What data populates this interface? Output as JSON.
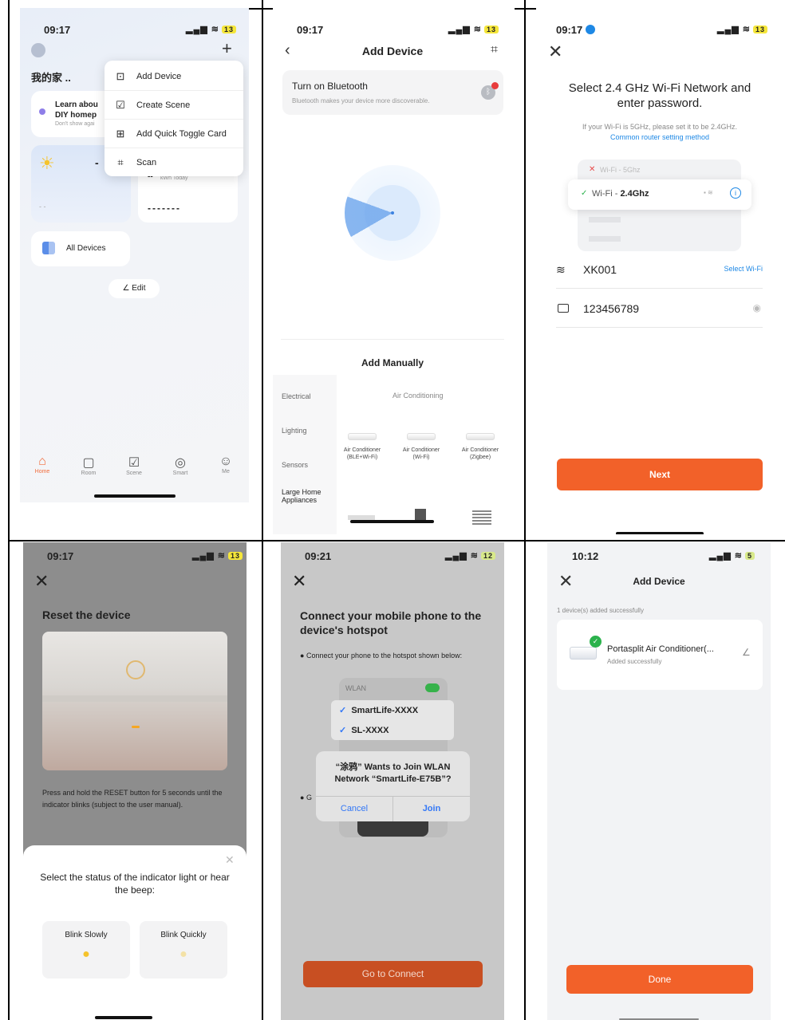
{
  "panel1": {
    "status": {
      "time": "09:17",
      "battery": "13"
    },
    "home_name": "我的家 ..",
    "promo_title": "Learn abou",
    "promo_title2": "DIY homep",
    "promo_sub": "Don't show agai",
    "energy_dash": "--",
    "energy_unit": "kWh Today",
    "energy_value": "-------",
    "weather_dash": "-",
    "weather_dash2": "- -",
    "all_devices": "All Devices",
    "edit": "Edit",
    "menu": [
      "Add Device",
      "Create Scene",
      "Add Quick Toggle Card",
      "Scan"
    ],
    "tabs": [
      "Home",
      "Room",
      "Scene",
      "Smart",
      "Me"
    ]
  },
  "panel2": {
    "status": {
      "time": "09:17",
      "battery": "13"
    },
    "title": "Add Device",
    "bt_title": "Turn on Bluetooth",
    "bt_sub": "Bluetooth makes your device more discoverable.",
    "add_manually": "Add Manually",
    "categories": [
      "Electrical",
      "Lighting",
      "Sensors",
      "Large Home Appliances"
    ],
    "section_label": "Air Conditioning",
    "products": [
      "Air Conditioner (BLE+Wi-Fi)",
      "Air Conditioner (Wi-Fi)",
      "Air Conditioner (Zigbee)"
    ]
  },
  "panel3": {
    "status": {
      "time": "09:17",
      "battery": "13"
    },
    "heading": "Select 2.4 GHz Wi-Fi Network and enter password.",
    "hint": "If your Wi-Fi is 5GHz, please set it to be 2.4GHz.",
    "link": "Common router setting method",
    "wifi_5g": "Wi-Fi - 5Ghz",
    "wifi_24_prefix": "Wi-Fi - ",
    "wifi_24_band": "2.4Ghz",
    "ssid": "XK001",
    "select_wifi": "Select Wi-Fi",
    "password": "123456789",
    "next": "Next"
  },
  "panel4": {
    "status": {
      "time": "09:17",
      "battery": "13"
    },
    "title": "Reset the device",
    "instructions": "Press and hold the RESET button for 5 seconds until the indicator blinks (subject to the user manual).",
    "sheet_title": "Select the status of the indicator light or hear the beep:",
    "blink_slowly": "Blink Slowly",
    "blink_quickly": "Blink Quickly"
  },
  "panel5": {
    "status": {
      "time": "09:21",
      "battery": "12"
    },
    "heading": "Connect your mobile phone to the device's hotspot",
    "step1": "Connect your phone to the hotspot shown below:",
    "wlan": "WLAN",
    "networks": [
      "SmartLife-XXXX",
      "SL-XXXX"
    ],
    "step2_bullet": "G",
    "dialog_title": "“涂鸦” Wants to Join WLAN Network “SmartLife-E75B”?",
    "cancel": "Cancel",
    "join": "Join",
    "go_connect": "Go to Connect"
  },
  "panel6": {
    "status": {
      "time": "10:12",
      "battery": "5"
    },
    "title": "Add Device",
    "count_text": "1 device(s) added successfully",
    "device_name": "Portasplit Air Conditioner(...",
    "device_status": "Added successfully",
    "done": "Done"
  },
  "colors": {
    "accent": "#f26129",
    "link": "#1e88e5"
  }
}
